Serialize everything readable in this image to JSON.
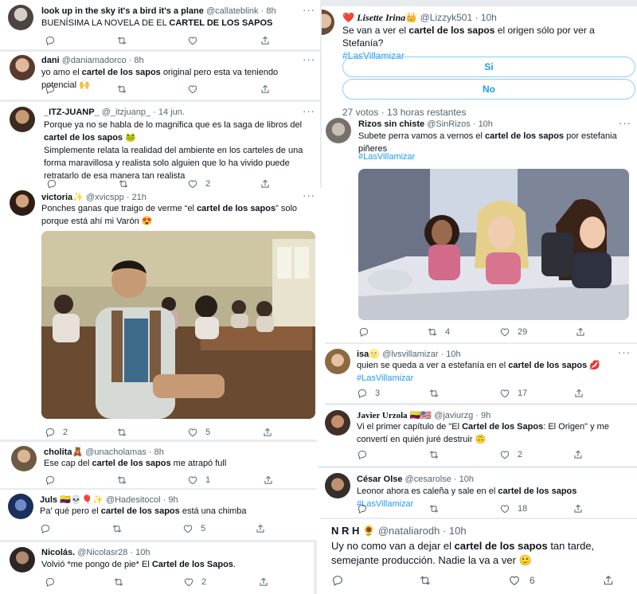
{
  "left": [
    {
      "name": "look up in the sky it's a bird it's a plane",
      "handle": "@callateblink",
      "time": "8h",
      "pre": "BUENÍSIMA LA NOVELA DE EL ",
      "bold": "CARTEL DE LOS SAPOS",
      "post": "",
      "actions": {
        "reply": "",
        "retweet": "",
        "like": "",
        "share": ""
      }
    },
    {
      "name": "dani",
      "handle": "@daniamadorco",
      "time": "8h",
      "pre": "yo amo el ",
      "bold": "cartel de los sapos",
      "post": " original pero esta va teniendo potencial 🙌",
      "actions": {
        "reply": "",
        "retweet": "",
        "like": "",
        "share": ""
      }
    },
    {
      "name": "_ITZ-JUANP_",
      "handle": "@_itzjuanp_",
      "time": "14 jun.",
      "pre": "Porque ya no se habla de lo magnifica que es la saga de libros del ",
      "bold": "cartel de los sapos",
      "post": " 🐸",
      "extra": "Simplemente relata la realidad del ambiente en los carteles de una forma maravillosa y realista solo alguien que lo ha vivido puede retratarlo de esa manera tan realista",
      "actions": {
        "reply": "",
        "retweet": "",
        "like": "2",
        "share": ""
      }
    },
    {
      "name": "victoria",
      "name_suffix": "✨",
      "handle": "@xvicspp",
      "time": "21h",
      "pre": "Ponches ganas que traigo de verme “el ",
      "bold": "cartel de los sapos",
      "post": "” solo porque está ahí mi Varón 😍",
      "actions": {
        "reply": "2",
        "retweet": "",
        "like": "5",
        "share": ""
      }
    },
    {
      "name": "cholita",
      "name_suffix": "🧸",
      "handle": "@unacholamas",
      "time": "8h",
      "pre": "Ese cap del ",
      "bold": "cartel de los sapos",
      "post": " me atrapó full",
      "actions": {
        "reply": "",
        "retweet": "",
        "like": "1",
        "share": ""
      }
    },
    {
      "name": "Juls",
      "name_suffix": "🇨🇴💀🎈✨",
      "handle": "@Hadesitocol",
      "time": "9h",
      "pre": "Pa' qué pero el ",
      "bold": "cartel de los sapos",
      "post": " está una chimba",
      "actions": {
        "reply": "",
        "retweet": "",
        "like": "5",
        "share": ""
      }
    },
    {
      "name": "Nicolás.",
      "handle": "@Nicolasr28",
      "time": "10h",
      "pre": "Volvió *me pongo de pie* El ",
      "bold": "Cartel de los Sapos",
      "post": ".",
      "actions": {
        "reply": "",
        "retweet": "",
        "like": "2",
        "share": ""
      }
    }
  ],
  "poll": {
    "name": "Lisette Irina",
    "name_prefix": "❤️",
    "name_suffix": "👑",
    "handle": "@Lizzyk501",
    "time": "10h",
    "pre": "Se van a ver el ",
    "bold": "cartel de los sapos",
    "post": " el origen sólo por ver a Stefanía?",
    "hashtag": "#LasVillamizar",
    "options": [
      "Si",
      "No"
    ],
    "votes": "27 votos",
    "remaining": "13 horas restantes"
  },
  "right": [
    {
      "name": "Rizos sin chiste",
      "handle": "@SinRizos",
      "time": "10h",
      "pre": "Subete perra vamos a vernos el ",
      "bold": "cartel de los sapos",
      "post": " por estefania piñeres",
      "hashtag": "#LasVillamizar",
      "actions": {
        "reply": "",
        "retweet": "4",
        "like": "29",
        "share": ""
      }
    },
    {
      "name": "isa",
      "name_suffix": "🌝",
      "handle": "@lvsvillamizar",
      "time": "10h",
      "pre": "quien se queda a ver a estefanía en el ",
      "bold": "cartel de los sapos",
      "post": " 💋",
      "hashtag": "#LasVillamizar",
      "actions": {
        "reply": "3",
        "retweet": "",
        "like": "17",
        "share": ""
      }
    },
    {
      "name": "Javier Urzola",
      "name_suffix": "🇨🇴🇺🇸",
      "handle": "@javiurzg",
      "time": "9h",
      "pre": "Vi el primer capítulo de \"El ",
      "bold": "Cartel de los Sapos",
      "post": ": El Origen\" y me convertí en quién juré destruir 🙃",
      "actions": {
        "reply": "",
        "retweet": "",
        "like": "2",
        "share": ""
      }
    },
    {
      "name": "César Olse",
      "handle": "@cesarolse",
      "time": "10h",
      "pre": "Leonor ahora es caleña y sale en el ",
      "bold": "cartel de los sapos",
      "post": " ",
      "hashtag": "#LasVillamizar",
      "actions": {
        "reply": "",
        "retweet": "",
        "like": "18",
        "share": ""
      }
    },
    {
      "name": "N R H",
      "name_suffix": "🌻",
      "handle": "@nataliarodh",
      "time": "10h",
      "pre": "Uy no como van a dejar el ",
      "bold": "cartel de los sapos",
      "post": " tan tarde, semejante producción. Nadie la va a ver 🙂",
      "actions": {
        "reply": "",
        "retweet": "",
        "like": "6",
        "share": ""
      }
    }
  ],
  "more_glyph": "···",
  "colors": {
    "accent": "#1d9bf0",
    "muted": "#536471",
    "text": "#0f1419",
    "poll_border": "#8ecdf8"
  }
}
